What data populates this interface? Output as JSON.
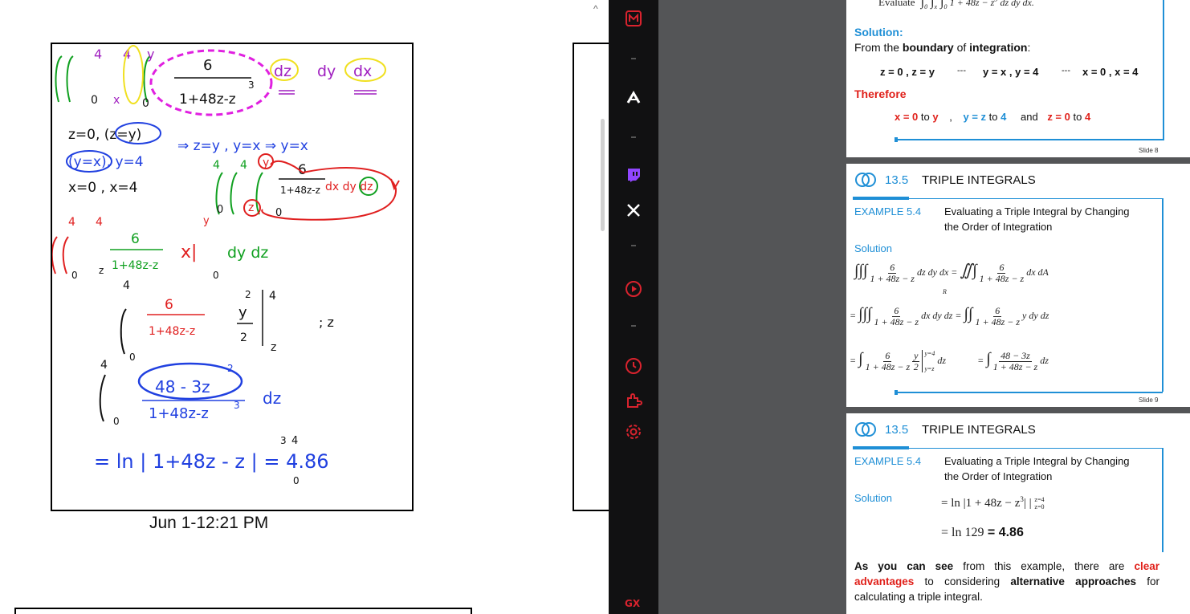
{
  "notebook": {
    "page_caption": "Jun 1-12:21 PM",
    "scroll_up_glyph": "^",
    "ink": {
      "problem_upper_limits": [
        "4",
        "4",
        "y"
      ],
      "problem_lower_limits": [
        "0",
        "x",
        "0"
      ],
      "problem_num": "6",
      "problem_den": "1+48z-z",
      "problem_den_exp": "3",
      "problem_diffs": [
        "dz",
        "dy",
        "dx"
      ],
      "boundary_line1": "z=0, (z=y)",
      "boundary_line2": "(y=x), y=4",
      "boundary_line3": "x=0 , x=4",
      "implies": "⇒ z=y , y=x ⇒ y=x",
      "reorder_limits_upper": [
        "4",
        "4",
        "y"
      ],
      "reorder_limits_lower": [
        "0",
        "z",
        "0"
      ],
      "reorder_num": "6",
      "reorder_den": "1+48z-z",
      "reorder_diffs": "dx dy dz",
      "step2_num": "6",
      "step2_den": "1+48z-z",
      "step2_eval": "x|",
      "step2_eval_upper": "y",
      "step2_eval_lower": "0",
      "step2_diffs": "dy dz",
      "step2_limits": [
        "4",
        "4",
        "0",
        "z"
      ],
      "step3_num": "6",
      "step3_den": "1+48z-z",
      "step3_y": "y",
      "step3_y_exp": "2",
      "step3_y_den": "2",
      "step3_limits_upper": "4",
      "step3_limits_lower": "z",
      "step3_int_limits": [
        "4",
        "0"
      ],
      "step3_note": "; z",
      "step4_num": "48 - 3z",
      "step4_num_exp": "2",
      "step4_den": "1+48z-z",
      "step4_den_exp": "3",
      "step4_diff": "dz",
      "step4_limits": [
        "4",
        "0"
      ],
      "final": "= ln | 1+48z - z | = 4.86",
      "final_exp": "3",
      "final_upper": "4",
      "final_lower": "0"
    }
  },
  "sidebar": {
    "brand": "GX",
    "icons": [
      {
        "name": "messenger-icon",
        "color": "#d9232e"
      },
      {
        "name": "arc-icon",
        "color": "#ffffff"
      },
      {
        "name": "twitch-icon",
        "color": "#9146ff"
      },
      {
        "name": "x-icon",
        "color": "#ffffff"
      },
      {
        "name": "player-icon",
        "color": "#d9232e"
      },
      {
        "name": "history-icon",
        "color": "#d9232e"
      },
      {
        "name": "extensions-icon",
        "color": "#d9232e"
      },
      {
        "name": "settings-icon",
        "color": "#d9232e"
      }
    ]
  },
  "slides": {
    "slide8": {
      "top_text": "Evaluate",
      "top_integrand": "dz dy dx.",
      "top_den": "1 + 48z − z",
      "solution_label": "Solution:",
      "boundary_prefix": "From the ",
      "boundary_bold": "boundary",
      "boundary_mid": " of ",
      "integration_bold": "integration",
      "boundary_suffix": ":",
      "eq_z": "z = 0 , z = y",
      "eq_sep1": "---",
      "eq_y": "y = x , y = 4",
      "eq_sep2": "---",
      "eq_x": "x = 0 , x = 4",
      "therefore": "Therefore",
      "range_x": "x = 0",
      "range_x_to": "to",
      "range_x_end": "y",
      "comma": ",",
      "range_y": "y = z",
      "range_y_to": "to",
      "range_y_end": "4",
      "and": "and",
      "range_z": "z = 0",
      "range_z_to": "to",
      "range_z_end": "4",
      "slide_number": "Slide 8"
    },
    "slide9": {
      "section_number": "13.5",
      "section_title": "TRIPLE INTEGRALS",
      "example_label": "EXAMPLE  5.4",
      "example_title_l1": "Evaluating a Triple Integral by Changing",
      "example_title_l2": "the Order of Integration",
      "solution_label": "Solution",
      "line1_num": "6",
      "line1_den": "1 + 48z − z",
      "line1_diff": "dz dy dx =",
      "line1_rhs_diff": "dx dA",
      "line1_region": "R",
      "line2_diff": "dx dy dz",
      "line2_rhs_diff": "y dy dz",
      "line3_frac_num": "y",
      "line3_frac_den": "2",
      "line3_eval_upper": "y=4",
      "line3_eval_lower": "y=z",
      "line3_diff": "dz",
      "line3_rhs_num": "48 − 3z",
      "line3_rhs_diff": "dz",
      "slide_number": "Slide 9"
    },
    "slide10": {
      "section_number": "13.5",
      "section_title": "TRIPLE INTEGRALS",
      "example_label": "EXAMPLE  5.4",
      "example_title_l1": "Evaluating a Triple Integral by Changing",
      "example_title_l2": "the Order of Integration",
      "solution_label": "Solution",
      "line1": "= ln |1 + 48z − z",
      "line1_tail": "| |",
      "line1_upper": "z=4",
      "line1_lower": "z=0",
      "line2_pre": "= ln 129",
      "line2_bold": "= 4.86",
      "para_p1": "As you can see",
      "para_p2": " from this example, there are ",
      "para_p3": "clear advantages",
      "para_p4": " to considering ",
      "para_p5": "alternative approaches",
      "para_p6": " for calculating a triple integral."
    }
  },
  "colors": {
    "accent_blue": "#1f8fd6",
    "accent_red": "#e0201a",
    "ink_green": "#10a020",
    "ink_red": "#e02020",
    "ink_purple": "#a020c0",
    "ink_magenta": "#e020e0",
    "ink_yellow": "#f0e020",
    "ink_blue": "#2040e0",
    "sidebar_bg": "#111112",
    "gap_bg": "#545557"
  }
}
